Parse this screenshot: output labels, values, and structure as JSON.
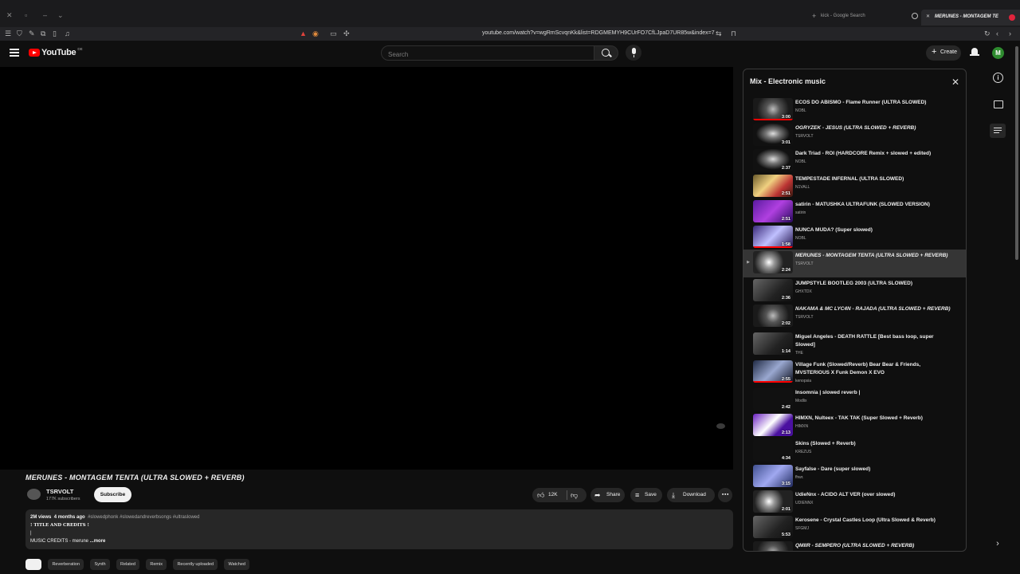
{
  "browser": {
    "tabs": [
      {
        "label": "kick - Google Search"
      },
      {
        "label": "MERUNES - MONTAGEM TE"
      }
    ],
    "url": "youtube.com/watch?v=wgRmScvqnKk&list=RDGMEMYH9CUrFO7CfLJpaD7UR85w&index=7"
  },
  "header": {
    "logo_text": "YouTube",
    "country": "DE",
    "search_placeholder": "Search",
    "create_label": "Create",
    "avatar_letter": "M"
  },
  "video": {
    "title": "MERUNES - MONTAGEM TENTA (ULTRA SLOWED + REVERB)",
    "channel": "TSRVOLT",
    "subscribers": "177K subscribers",
    "subscribe_label": "Subscribe",
    "likes": "12K",
    "share_label": "Share",
    "save_label": "Save",
    "download_label": "Download",
    "views": "2M views",
    "age": "4 months ago",
    "tags": "#slowedphonk #slowedandreverbsongs #ultraslowed",
    "desc_line1": "! TITLE AND CREDITS !",
    "desc_line2": "|",
    "desc_line3": "MUSIC CREDITS - merune",
    "more_label": "...more"
  },
  "chips": [
    "",
    "Reverberation",
    "Synth",
    "Related",
    "Remix",
    "Recently uploaded",
    "Watched"
  ],
  "playlist": {
    "title": "Mix - Electronic music",
    "items": [
      {
        "title": "ECOS DO ABISMO - Flame Runner (ULTRA SLOWED)",
        "channel": "NOBL",
        "duration": "3:00",
        "thumb": "t-dark",
        "italic": false,
        "current": false,
        "tall": false,
        "watched": true
      },
      {
        "title": "OGRYZEK - JESUS (ULTRA SLOWED + REVERB)",
        "channel": "TSRVOLT",
        "duration": "3:01",
        "thumb": "t-face",
        "italic": true,
        "current": false,
        "tall": false,
        "watched": false
      },
      {
        "title": "Dark Triad - ROI (HARDCORE Remix + slowed + edited)",
        "channel": "NOBL",
        "duration": "2:37",
        "thumb": "t-face",
        "italic": false,
        "current": false,
        "tall": false,
        "watched": false
      },
      {
        "title": "TEMPESTADE INFERNAL (ULTRA SLOWED)",
        "channel": "N1VALL",
        "duration": "2:51",
        "thumb": "t-fire",
        "italic": false,
        "current": false,
        "tall": false,
        "watched": false
      },
      {
        "title": "satirin - MATUSHKA ULTRAFUNK (SLOWED VERSION)",
        "channel": "satirin",
        "duration": "2:51",
        "thumb": "t-purple",
        "italic": false,
        "current": false,
        "tall": false,
        "watched": false
      },
      {
        "title": "NUNCA MUDA? (Super slowed)",
        "channel": "NOBL",
        "duration": "1:58",
        "thumb": "t-night",
        "italic": false,
        "current": false,
        "tall": false,
        "watched": true
      },
      {
        "title": "MERUNES - MONTAGEM TENTA (ULTRA SLOWED + REVERB)",
        "channel": "TSRVOLT",
        "duration": "2:24",
        "thumb": "t-bw",
        "italic": true,
        "current": true,
        "tall": true,
        "watched": false
      },
      {
        "title": "JUMPSTYLE BOOTLEG 2003 (ULTRA SLOWED)",
        "channel": "GHXTDX",
        "duration": "2:36",
        "thumb": "t-grey",
        "italic": false,
        "current": false,
        "tall": false,
        "watched": false
      },
      {
        "title": "NAKAMA & MC LYC4N - RAJADA (ULTRA SLOWED + REVERB)",
        "channel": "TSRVOLT",
        "duration": "2:02",
        "thumb": "t-dark",
        "italic": true,
        "current": false,
        "tall": true,
        "watched": false
      },
      {
        "title": "Miguel Angeles - DEATH RATTLE [Best bass loop, super Slowed]",
        "channel": "THE",
        "duration": "1:14",
        "thumb": "t-grey",
        "italic": false,
        "current": false,
        "tall": true,
        "watched": false
      },
      {
        "title": "Village Funk (Slowed/Reverb) Bear Bear & Friends, MVSTERIOUS X Funk Demon X EVO",
        "channel": "kenopsia",
        "duration": "2:55",
        "thumb": "t-cyan",
        "italic": false,
        "current": false,
        "tall": true,
        "watched": true
      },
      {
        "title": "Insomnia | slowed reverb |",
        "channel": "Modlix",
        "duration": "2:42",
        "thumb": "t-black",
        "italic": false,
        "current": false,
        "tall": false,
        "watched": false
      },
      {
        "title": "HIMXN, Nulteex - TAK TAK (Super Slowed + Reverb)",
        "channel": "HIMXN",
        "duration": "2:13",
        "thumb": "t-tak",
        "italic": false,
        "current": false,
        "tall": false,
        "watched": false
      },
      {
        "title": "Skins (Slowed + Reverb)",
        "channel": "KREZUS",
        "duration": "4:34",
        "thumb": "t-black",
        "italic": false,
        "current": false,
        "tall": false,
        "watched": false
      },
      {
        "title": "Sayfalse - Dare (super slowed)",
        "channel": "fhwr.",
        "duration": "3:15",
        "thumb": "t-blue",
        "italic": false,
        "current": false,
        "tall": false,
        "watched": false
      },
      {
        "title": "UdieNnx - ACIDO ALT VER (over slowed)",
        "channel": "UDIENNX",
        "duration": "2:01",
        "thumb": "t-bw",
        "italic": false,
        "current": false,
        "tall": false,
        "watched": false
      },
      {
        "title": "Kerosene - Crystal Castles Loop (Ultra Slowed & Reverb)",
        "channel": "SFGMJ",
        "duration": "5:53",
        "thumb": "t-grey",
        "italic": false,
        "current": false,
        "tall": false,
        "watched": false
      },
      {
        "title": "QMIIR - SEMPERO (ULTRA SLOWED + REVERB)",
        "channel": "",
        "duration": "",
        "thumb": "t-dark",
        "italic": true,
        "current": false,
        "tall": false,
        "watched": false
      }
    ]
  }
}
